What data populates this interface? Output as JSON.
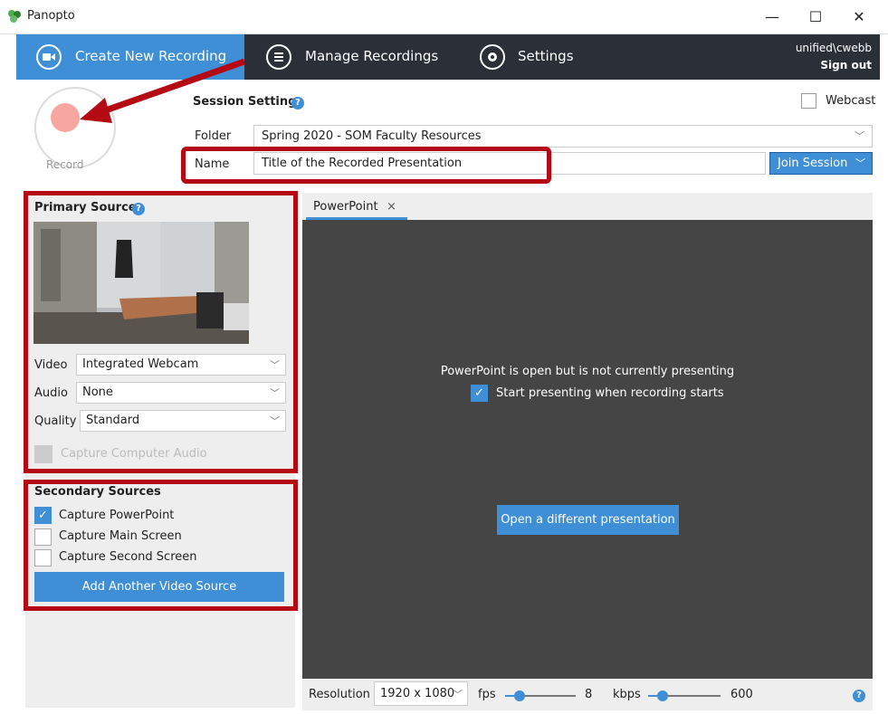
{
  "window": {
    "title": "Panopto",
    "minimize": "—",
    "maximize": "☐",
    "close": "✕"
  },
  "nav": {
    "create_label": "Create New Recording",
    "manage_label": "Manage Recordings",
    "settings_label": "Settings",
    "user": "unified\\cwebb",
    "sign_out": "Sign out"
  },
  "record": {
    "label": "Record"
  },
  "session": {
    "title": "Session Settings",
    "webcast_label": "Webcast",
    "folder_label": "Folder",
    "folder_value": "Spring 2020 - SOM Faculty Resources",
    "name_label": "Name",
    "name_value": "Title of the Recorded Presentation",
    "join_label": "Join Session"
  },
  "primary": {
    "title": "Primary Sources",
    "video_label": "Video",
    "video_value": "Integrated Webcam",
    "audio_label": "Audio",
    "audio_value": "None",
    "quality_label": "Quality",
    "quality_value": "Standard",
    "capture_audio_label": "Capture Computer Audio"
  },
  "secondary": {
    "title": "Secondary Sources",
    "items": [
      {
        "label": "Capture PowerPoint",
        "checked": true
      },
      {
        "label": "Capture Main Screen",
        "checked": false
      },
      {
        "label": "Capture Second Screen",
        "checked": false
      }
    ],
    "add_label": "Add Another Video Source"
  },
  "preview": {
    "tab_label": "PowerPoint",
    "tab_close": "×",
    "message": "PowerPoint is open but is not currently presenting",
    "start_label": "Start presenting when recording starts",
    "open_label": "Open a different presentation"
  },
  "bottom": {
    "resolution_label": "Resolution",
    "resolution_value": "1920 x 1080",
    "fps_label": "fps",
    "fps_value": "8",
    "kbps_label": "kbps",
    "kbps_value": "600"
  },
  "colors": {
    "accent": "#3e8fd6",
    "nav_bg": "#2a2f38",
    "annotation": "#b40a14"
  }
}
